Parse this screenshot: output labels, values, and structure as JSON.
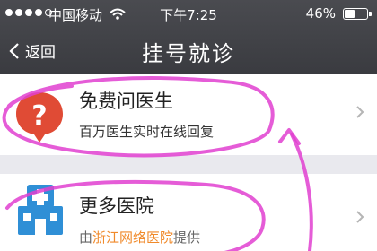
{
  "status_bar": {
    "carrier": "中国移动",
    "time": "下午7:25",
    "battery": "46%",
    "battery_level": 0.46
  },
  "nav": {
    "back_label": "返回",
    "title": "挂号就诊"
  },
  "rows": [
    {
      "title": "免费问医生",
      "subtitle": "百万医生实时在线回复",
      "icon": "question-bubble-icon"
    },
    {
      "title": "更多医院",
      "subtitle_prefix": "由",
      "subtitle_highlight": "浙江网络医院",
      "subtitle_suffix": "提供",
      "icon": "hospital-icon"
    }
  ],
  "colors": {
    "header": "#3f4045",
    "question_icon": "#e04b35",
    "hospital_icon": "#2f8fd6",
    "highlight": "#f08a2b",
    "annotation": "#e040d0"
  }
}
